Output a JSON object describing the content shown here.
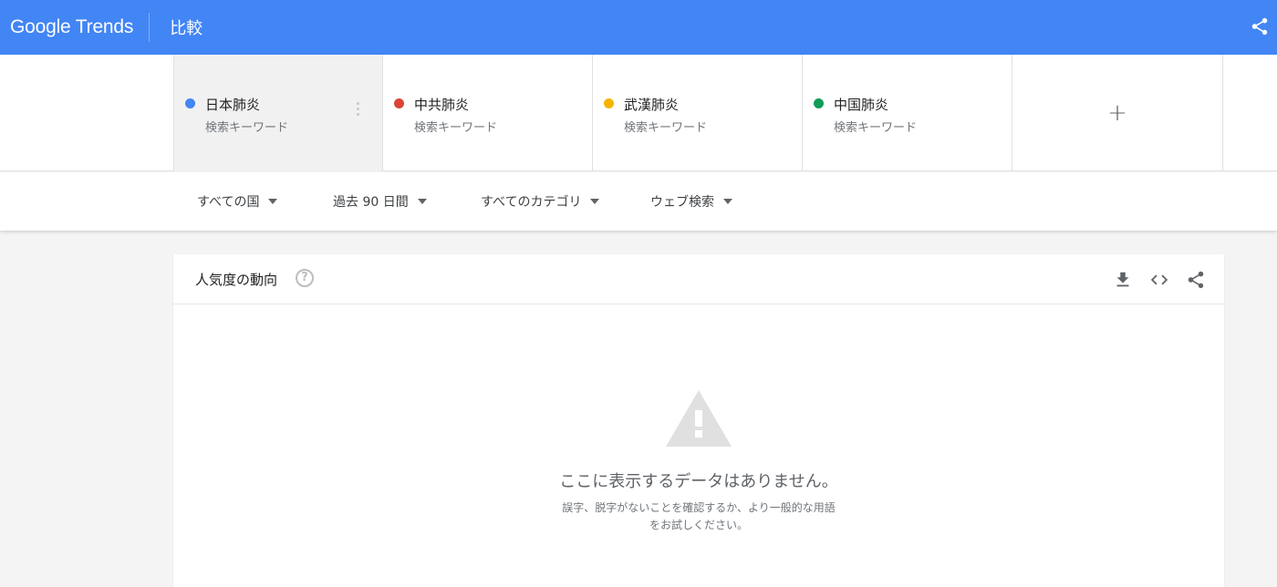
{
  "header": {
    "logo_google": "Google",
    "logo_trends": "Trends",
    "page_title": "比較",
    "share_icon": "share-icon",
    "background_color": "#4285f4"
  },
  "terms": [
    {
      "name": "日本肺炎",
      "sub": "検索キーワード",
      "color": "#4285f4"
    },
    {
      "name": "中共肺炎",
      "sub": "検索キーワード",
      "color": "#db4437"
    },
    {
      "name": "武漢肺炎",
      "sub": "検索キーワード",
      "color": "#f4b400"
    },
    {
      "name": "中国肺炎",
      "sub": "検索キーワード",
      "color": "#0f9d58"
    }
  ],
  "add_term_label": "+",
  "filters": [
    {
      "label": "すべての国"
    },
    {
      "label": "過去 90 日間"
    },
    {
      "label": "すべてのカテゴリ"
    },
    {
      "label": "ウェブ検索"
    }
  ],
  "card": {
    "title": "人気度の動向",
    "help_label": "?",
    "actions": [
      "download-icon",
      "embed-code-icon",
      "share-icon"
    ],
    "empty_title": "ここに表示するデータはありません。",
    "empty_desc_line1": "誤字、脱字がないことを確認するか、より一般的な用語",
    "empty_desc_line2": "をお試しください。"
  }
}
